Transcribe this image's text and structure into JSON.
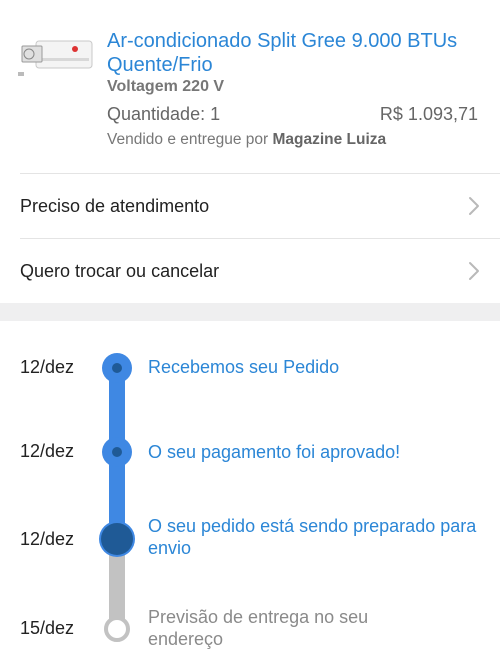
{
  "product": {
    "title": "Ar-condicionado Split Gree 9.000 BTUs Quente/Frio",
    "voltage": "Voltagem 220 V",
    "quantity": "Quantidade: 1",
    "price": "R$ 1.093,71",
    "sold_by_prefix": "Vendido e entregue por",
    "seller": "Magazine Luiza"
  },
  "actions": [
    {
      "label": "Preciso de atendimento",
      "icon": "chevron-right-icon"
    },
    {
      "label": "Quero trocar ou cancelar",
      "icon": "chevron-right-icon"
    }
  ],
  "timeline": [
    {
      "date": "12/dez",
      "text": "Recebemos seu Pedido",
      "status": "done"
    },
    {
      "date": "12/dez",
      "text": "O seu pagamento foi aprovado!",
      "status": "done"
    },
    {
      "date": "12/dez",
      "text": "O seu pedido está sendo preparado para envio",
      "status": "current"
    },
    {
      "date": "15/dez",
      "text": "Previsão de entrega no seu endereço",
      "status": "pending"
    }
  ],
  "colors": {
    "link_blue": "#2b86d6",
    "timeline_blue": "#3f88e3",
    "current_node": "#1f5a96",
    "pending_gray": "#c2c2c2"
  }
}
